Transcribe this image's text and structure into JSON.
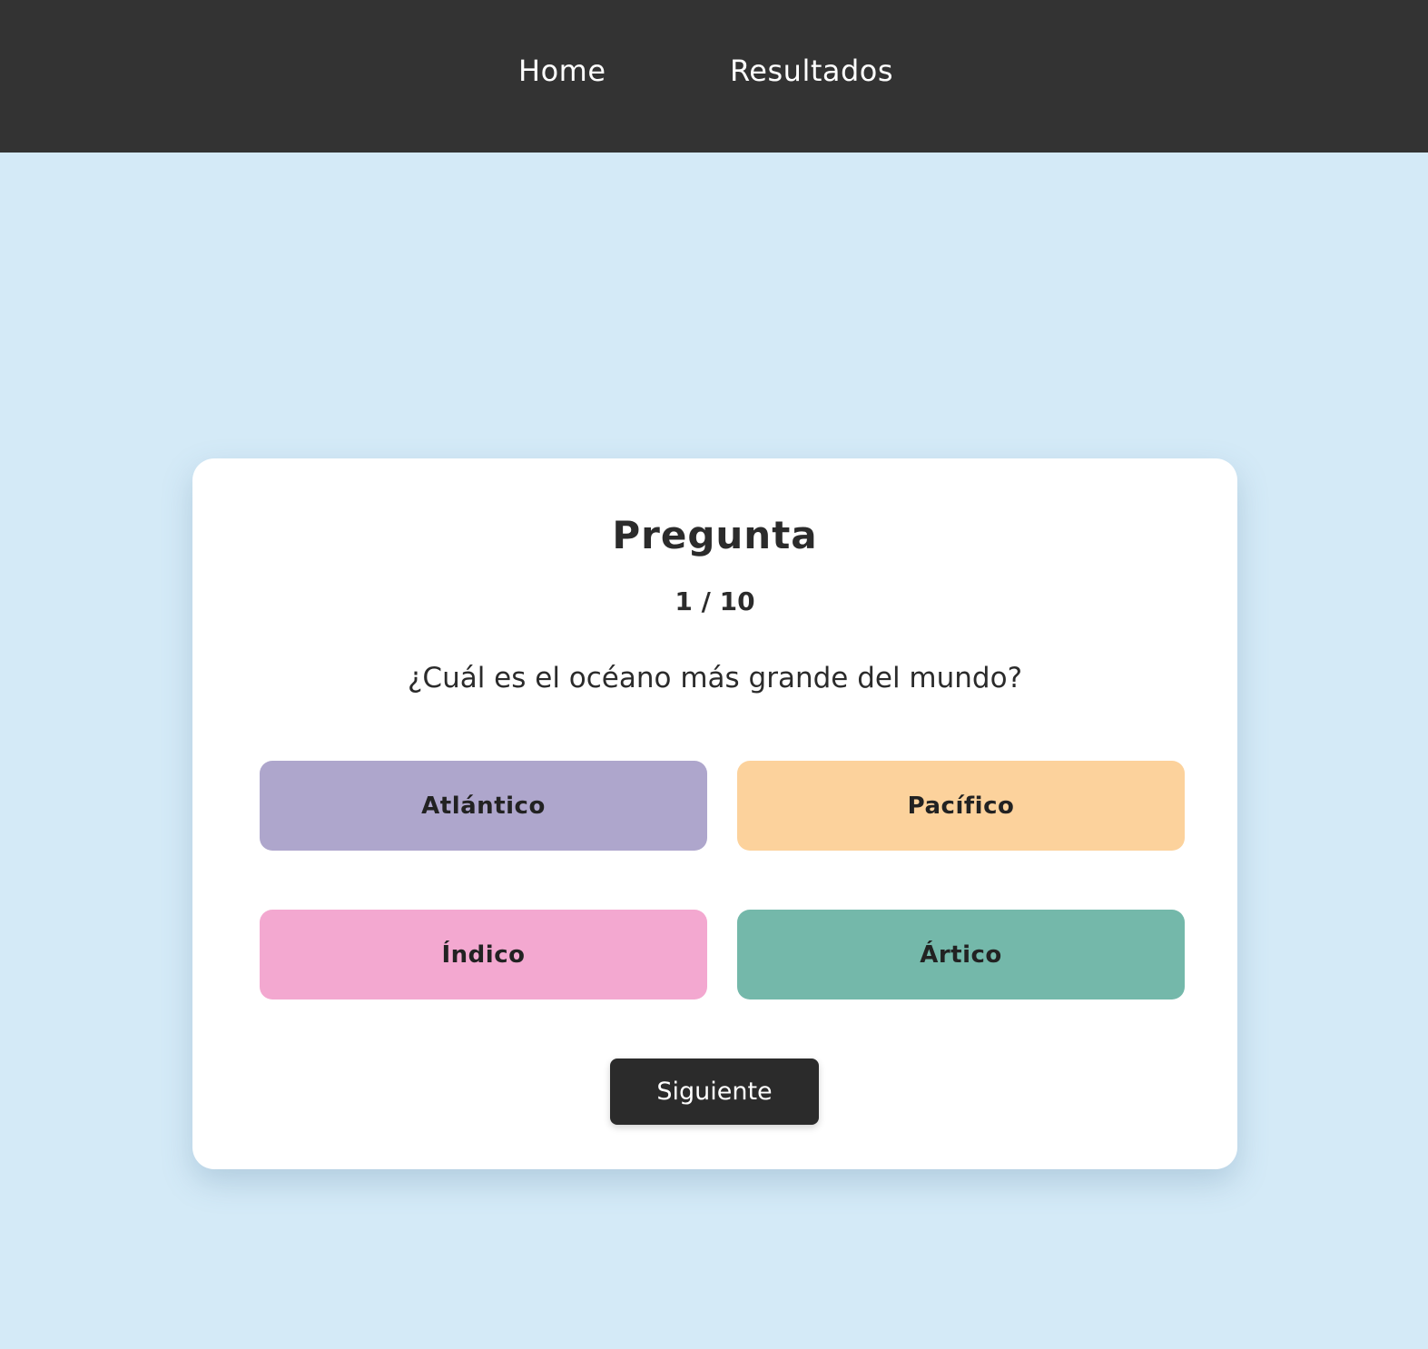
{
  "nav": {
    "home_label": "Home",
    "results_label": "Resultados"
  },
  "quiz": {
    "title": "Pregunta",
    "counter": "1 / 10",
    "question": "¿Cuál es el océano más grande del mundo?",
    "answers": [
      {
        "label": "Atlántico",
        "color": "#aea6cc"
      },
      {
        "label": "Pacífico",
        "color": "#fcd29c"
      },
      {
        "label": "Índico",
        "color": "#f3a8d0"
      },
      {
        "label": "Ártico",
        "color": "#74b8aa"
      }
    ],
    "next_label": "Siguiente"
  },
  "colors": {
    "page_background": "#d4eaf7",
    "navbar_background": "#333333",
    "card_background": "#ffffff",
    "button_dark": "#2b2b2b"
  }
}
